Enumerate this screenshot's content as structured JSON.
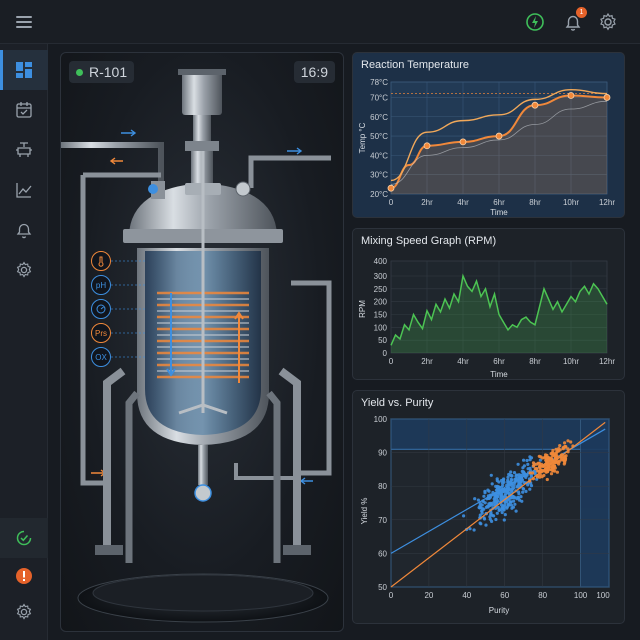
{
  "header": {
    "menu_icon": "hamburger-menu-icon",
    "power_icon": "power-status-icon",
    "power_color": "#3fbf5a",
    "notifications_icon": "bell-icon",
    "notification_count": "1",
    "settings_icon": "gear-icon"
  },
  "sidebar": {
    "items": [
      {
        "icon": "dashboard-icon",
        "active": true
      },
      {
        "icon": "calendar-icon",
        "active": false
      },
      {
        "icon": "valve-icon",
        "active": false
      },
      {
        "icon": "trend-chart-icon",
        "active": false
      },
      {
        "icon": "bell-icon",
        "active": false
      },
      {
        "icon": "gear-icon",
        "active": false
      }
    ],
    "bottom_items": [
      {
        "icon": "clock-check-icon",
        "color": "#3fbf5a"
      },
      {
        "icon": "alert-icon",
        "color": "#e5622a"
      },
      {
        "icon": "gear-icon"
      }
    ]
  },
  "reactor": {
    "id_label": "R-101",
    "status_color": "#3fbf5a",
    "aspect_label": "16:9",
    "sensors": [
      {
        "label": "",
        "icon": "thermometer-icon",
        "color": "#f0883a"
      },
      {
        "label": "pH",
        "color": "#3d8fe0"
      },
      {
        "label": "",
        "icon": "pressure-gauge-icon",
        "color": "#3d8fe0"
      },
      {
        "label": "Prs",
        "color": "#f0883a"
      },
      {
        "label": "OX",
        "color": "#3d8fe0"
      }
    ]
  },
  "charts": {
    "temperature": {
      "title": "Reaction Temperature",
      "xlabel": "Time",
      "ylabel": "Temp °C"
    },
    "mixing": {
      "title": "Mixing Speed Graph (RPM)",
      "xlabel": "Time",
      "ylabel": "RPM"
    },
    "yield": {
      "title": "Yield vs. Purity",
      "xlabel": "Purity",
      "ylabel": "Yield %"
    }
  },
  "chart_data": [
    {
      "type": "line",
      "title": "Reaction Temperature",
      "xlabel": "Time",
      "ylabel": "Temp °C",
      "x_ticks": [
        "0",
        "2hr",
        "4hr",
        "6hr",
        "8hr",
        "10hr",
        "12hr"
      ],
      "y_ticks": [
        "20°C",
        "30°C",
        "40°C",
        "50°C",
        "60°C",
        "70°C",
        "78°C"
      ],
      "xlim": [
        0,
        12
      ],
      "ylim": [
        20,
        78
      ],
      "grid": true,
      "series": [
        {
          "color": "#f0883a",
          "x": [
            0,
            1,
            2,
            4,
            6,
            8,
            10,
            12
          ],
          "values": [
            23,
            35,
            45,
            47,
            50,
            66,
            71,
            70
          ],
          "markers": [
            0,
            2,
            4,
            6,
            8,
            10,
            12
          ]
        },
        {
          "color": "#f0a85a",
          "x": [
            0,
            2,
            4,
            6,
            8,
            10,
            12
          ],
          "values": [
            27,
            52,
            58,
            61,
            69,
            74,
            72
          ],
          "dashed": false
        },
        {
          "color": "#c9ced4",
          "x": [
            0,
            2,
            4,
            6,
            8,
            10,
            12
          ],
          "values": [
            25,
            40,
            44,
            48,
            56,
            64,
            68
          ],
          "thin": true
        }
      ],
      "reference_lines": [
        {
          "y": 72,
          "dashed": true,
          "color": "#f0883a"
        }
      ]
    },
    {
      "type": "area",
      "title": "Mixing Speed Graph (RPM)",
      "xlabel": "Time",
      "ylabel": "RPM",
      "x_ticks": [
        "0",
        "2hr",
        "4hr",
        "6hr",
        "8hr",
        "10hr",
        "12hr"
      ],
      "y_ticks": [
        "0",
        "50",
        "100",
        "150",
        "200",
        "250",
        "300",
        "400"
      ],
      "xlim": [
        0,
        12
      ],
      "grid": true,
      "series": [
        {
          "color": "#4cc453",
          "x": [
            0,
            0.25,
            0.5,
            0.75,
            1,
            1.25,
            1.5,
            1.75,
            2,
            2.25,
            2.5,
            2.75,
            3,
            3.25,
            3.5,
            3.75,
            4,
            4.25,
            4.5,
            4.75,
            5,
            5.25,
            5.5,
            5.75,
            6,
            6.25,
            6.5,
            6.75,
            7,
            7.25,
            7.5,
            7.75,
            8,
            8.25,
            8.5,
            8.75,
            9,
            9.25,
            9.5,
            9.75,
            10,
            10.25,
            10.5,
            10.75,
            11,
            11.25,
            11.5,
            11.75,
            12
          ],
          "values": [
            30,
            70,
            55,
            110,
            90,
            150,
            120,
            95,
            165,
            130,
            190,
            160,
            210,
            175,
            230,
            200,
            300,
            260,
            240,
            280,
            220,
            250,
            180,
            230,
            150,
            120,
            90,
            110,
            100,
            130,
            140,
            120,
            110,
            180,
            250,
            210,
            170,
            200,
            160,
            190,
            220,
            200,
            240,
            260,
            230,
            270,
            250,
            220,
            190
          ]
        }
      ]
    },
    {
      "type": "scatter",
      "title": "Yield vs. Purity",
      "xlabel": "Purity",
      "ylabel": "Yield %",
      "x_ticks": [
        "0",
        "20",
        "40",
        "60",
        "80",
        "100",
        "100"
      ],
      "y_ticks": [
        "50",
        "60",
        "70",
        "80",
        "90",
        "100"
      ],
      "xlim": [
        0,
        115
      ],
      "ylim": [
        50,
        100
      ],
      "grid": true,
      "series": [
        {
          "color": "#3d8fe0",
          "x_range": [
            0,
            95
          ],
          "trend": [
            [
              0,
              60
            ],
            [
              113,
              97
            ]
          ],
          "n": 330
        },
        {
          "color": "#f0883a",
          "x_range": [
            55,
            110
          ],
          "trend": [
            [
              0,
              50
            ],
            [
              113,
              99
            ]
          ],
          "n": 180
        }
      ]
    }
  ]
}
